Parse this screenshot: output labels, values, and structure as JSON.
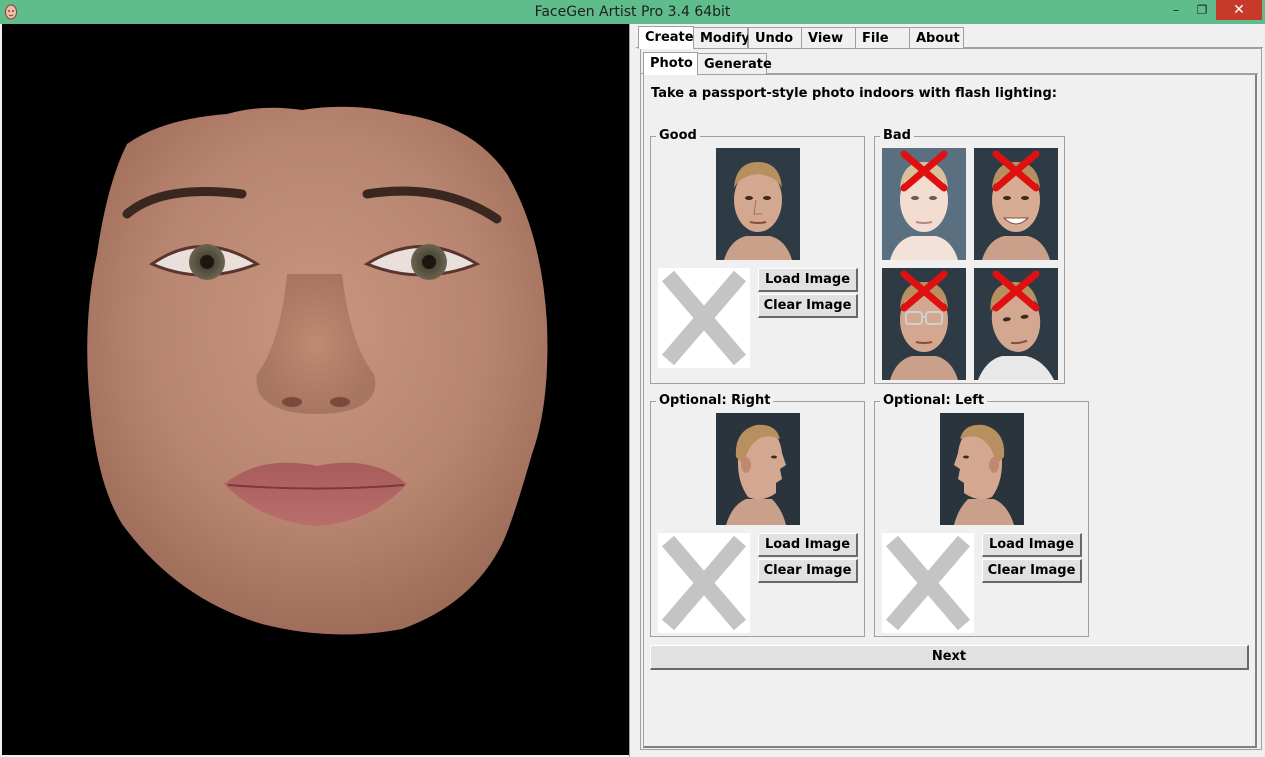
{
  "window": {
    "title": "FaceGen Artist Pro 3.4 64bit",
    "minimize_glyph": "–",
    "maximize_glyph": "❐",
    "close_glyph": "✕"
  },
  "main_tabs": [
    {
      "label": "Create",
      "active": true
    },
    {
      "label": "Modify",
      "active": false
    },
    {
      "label": "Undo",
      "active": false
    },
    {
      "label": "View",
      "active": false
    },
    {
      "label": "File",
      "active": false
    },
    {
      "label": "About",
      "active": false
    }
  ],
  "sub_tabs": [
    {
      "label": "Photo",
      "active": true
    },
    {
      "label": "Generate",
      "active": false
    }
  ],
  "photo_page": {
    "instruction": "Take a passport-style photo indoors with flash lighting:",
    "groups": {
      "good": {
        "label": "Good",
        "load_label": "Load Image",
        "clear_label": "Clear Image"
      },
      "bad": {
        "label": "Bad"
      },
      "right": {
        "label": "Optional: Right",
        "load_label": "Load Image",
        "clear_label": "Clear Image"
      },
      "left": {
        "label": "Optional: Left",
        "load_label": "Load Image",
        "clear_label": "Clear Image"
      }
    },
    "next_label": "Next"
  },
  "colors": {
    "titlebar": "#5ebd8b",
    "close_button": "#c73a2a",
    "placeholder_x": "#c4c4c4",
    "bad_mark": "#e01010"
  }
}
